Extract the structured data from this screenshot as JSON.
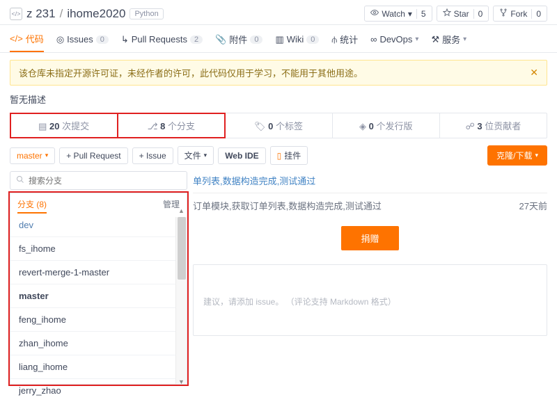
{
  "header": {
    "owner": "z        231",
    "name": "ihome2020",
    "lang": "Python"
  },
  "repoActions": {
    "watch": {
      "label": "Watch",
      "count": "5"
    },
    "star": {
      "label": "Star",
      "count": "0"
    },
    "fork": {
      "label": "Fork",
      "count": "0"
    }
  },
  "tabs": {
    "code": {
      "label": "代码"
    },
    "issues": {
      "label": "Issues",
      "count": "0"
    },
    "pr": {
      "label": "Pull Requests",
      "count": "2"
    },
    "attach": {
      "label": "附件",
      "count": "0"
    },
    "wiki": {
      "label": "Wiki",
      "count": "0"
    },
    "stat": {
      "label": "统计"
    },
    "devops": {
      "label": "DevOps"
    },
    "service": {
      "label": "服务"
    }
  },
  "alert": {
    "text": "该仓库未指定开源许可证，未经作者的许可，此代码仅用于学习，不能用于其他用途。"
  },
  "desc": "暂无描述",
  "stats": {
    "commits": {
      "num": "20",
      "label": "次提交"
    },
    "branches": {
      "num": "8",
      "label": "个分支"
    },
    "tags": {
      "num": "0",
      "label": "个标签"
    },
    "releases": {
      "num": "0",
      "label": "个发行版"
    },
    "contributors": {
      "num": "3",
      "label": "位贡献者"
    }
  },
  "toolbar": {
    "branchSelector": "master",
    "pr": "+ Pull Request",
    "issue": "+ Issue",
    "files": "文件",
    "webide": "Web IDE",
    "widget": "挂件",
    "clone": "克隆/下载"
  },
  "branchSearch": {
    "placeholder": "搜索分支"
  },
  "branchPanel": {
    "tabLabel": "分支 (8)",
    "manage": "管理",
    "items": [
      "dev",
      "fs_ihome",
      "revert-merge-1-master",
      "master",
      "feng_ihome",
      "zhan_ihome",
      "liang_ihome",
      "jerry_zhao"
    ],
    "selected": "master"
  },
  "commit": {
    "titleFragment": "单列表,数据构造完成,测试通过",
    "msg": "订单模块,获取订单列表,数据构造完成,测试通过",
    "time": "27天前"
  },
  "donate": "捐赠",
  "issueHint": "建议，请添加 issue。   （评论支持 Markdown 格式）"
}
